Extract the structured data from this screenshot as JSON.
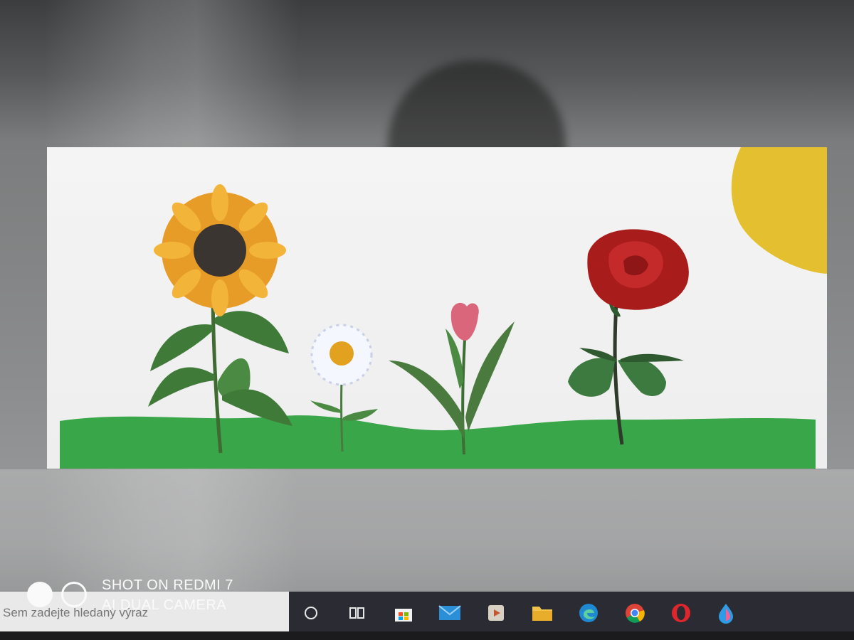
{
  "taskbar": {
    "search_placeholder": "Sem zadejte hledaný výraz",
    "icons": [
      "cortana-icon",
      "task-view-icon",
      "store-icon",
      "mail-icon",
      "media-player-icon",
      "file-explorer-icon",
      "edge-icon",
      "chrome-icon",
      "opera-icon",
      "paint-icon"
    ]
  },
  "watermark": {
    "line1": "SHOT ON REDMI 7",
    "line2": "AI DUAL CAMERA"
  },
  "drawing": {
    "flowers": [
      "sunflower",
      "daisy",
      "tulip",
      "rose"
    ],
    "colors": {
      "grass": "#3aa84a",
      "sun": "#e6c22e",
      "rose": "#b82222",
      "tulip": "#d96a7a",
      "sunflower": "#e8a12c",
      "leaf": "#3b6d36"
    }
  }
}
